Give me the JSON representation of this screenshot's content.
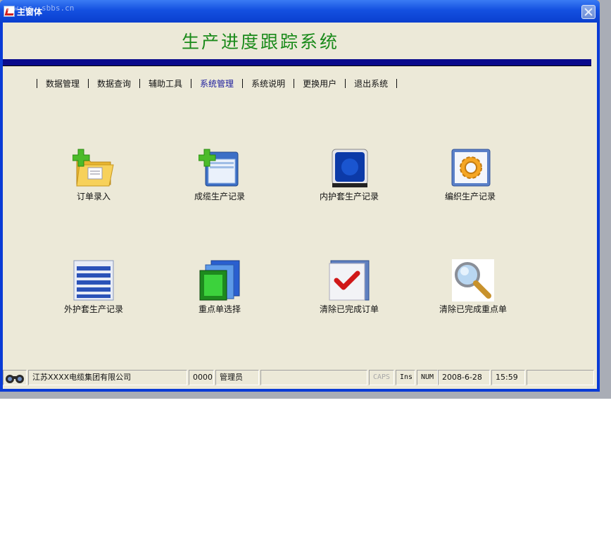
{
  "window": {
    "title": "主窗体",
    "watermark": "www.pc..sbbs.cn"
  },
  "app": {
    "title": "生产进度跟踪系统"
  },
  "menu": [
    {
      "label": "数据管理",
      "active": false
    },
    {
      "label": "数据查询",
      "active": false
    },
    {
      "label": "辅助工具",
      "active": false
    },
    {
      "label": "系统管理",
      "active": true
    },
    {
      "label": "系统说明",
      "active": false
    },
    {
      "label": "更换用户",
      "active": false
    },
    {
      "label": "退出系统",
      "active": false
    }
  ],
  "tiles": [
    {
      "label": "订单录入",
      "icon": "folder-add-icon"
    },
    {
      "label": "成缆生产记录",
      "icon": "window-add-icon"
    },
    {
      "label": "内护套生产记录",
      "icon": "monitor-blue-icon"
    },
    {
      "label": "编织生产记录",
      "icon": "gear-icon"
    },
    {
      "label": "外护套生产记录",
      "icon": "list-document-icon"
    },
    {
      "label": "重点单选择",
      "icon": "picture-stack-icon"
    },
    {
      "label": "清除已完成订单",
      "icon": "checkmark-icon"
    },
    {
      "label": "清除已完成重点单",
      "icon": "magnifier-icon"
    }
  ],
  "statusbar": {
    "company": "江苏XXXX电缆集团有限公司",
    "user_code": "0000",
    "user_role": "管理员",
    "caps": "CAPS",
    "ins": "Ins",
    "num": "NUM",
    "date": "2008-6-28",
    "time": "15:59"
  }
}
